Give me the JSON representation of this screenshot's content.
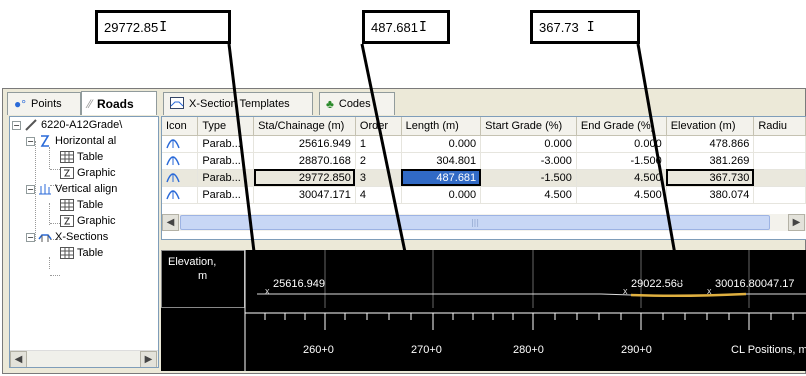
{
  "callouts": {
    "chainage_value": "29772.85",
    "length_value": "487.681",
    "elevation_value": "367.73",
    "cursor": "I"
  },
  "tabs": [
    {
      "label": "Points",
      "icon": "points-icon"
    },
    {
      "label": "Roads",
      "icon": "roads-icon",
      "active": true
    },
    {
      "label": "X-Section Templates",
      "icon": "x-section-templates-icon"
    },
    {
      "label": "Codes",
      "icon": "codes-icon"
    }
  ],
  "tree": {
    "root": "6220-A12Grade\\",
    "horizontal": "Horizontal al",
    "horizontal_table": "Table",
    "horizontal_graphic": "Graphic",
    "vertical": "Vertical align",
    "vertical_table": "Table",
    "vertical_graphic": "Graphic",
    "xsections": "X-Sections",
    "xsections_table": "Table",
    "expand_minus": "−"
  },
  "grid": {
    "headers": [
      "Icon",
      "Type",
      "Sta/Chainage (m)",
      "Order",
      "Length (m)",
      "Start Grade (%)",
      "End Grade (%)",
      "Elevation (m)",
      "Radiu"
    ],
    "rows": [
      {
        "type": "Parab...",
        "chainage": "25616.949",
        "order": "1",
        "length": "0.000",
        "start_grade": "0.000",
        "end_grade": "0.000",
        "elevation": "478.866"
      },
      {
        "type": "Parab...",
        "chainage": "28870.168",
        "order": "2",
        "length": "304.801",
        "start_grade": "-3.000",
        "end_grade": "-1.500",
        "elevation": "381.269"
      },
      {
        "type": "Parab...",
        "chainage": "29772.850",
        "order": "3",
        "length": "487.681",
        "start_grade": "-1.500",
        "end_grade": "4.500",
        "elevation": "367.730"
      },
      {
        "type": "Parab...",
        "chainage": "30047.171",
        "order": "4",
        "length": "0.000",
        "start_grade": "4.500",
        "end_grade": "4.500",
        "elevation": "380.074"
      }
    ],
    "scroll_grip": "|||"
  },
  "profile": {
    "ylabel_line1": "Elevation,",
    "ylabel_line2": "m",
    "pt1": "25616.949",
    "pt2": "29022.568",
    "pt3": "30016.80047.17",
    "ticks": [
      "260+0",
      "270+0",
      "280+0",
      "290+0"
    ],
    "axis_label": "CL Positions, m",
    "marker": "x"
  },
  "colors": {
    "selection": "#316AC5",
    "profile_bg": "#000000",
    "window_bg": "#ECE9D8",
    "curve": "#E0B040"
  }
}
